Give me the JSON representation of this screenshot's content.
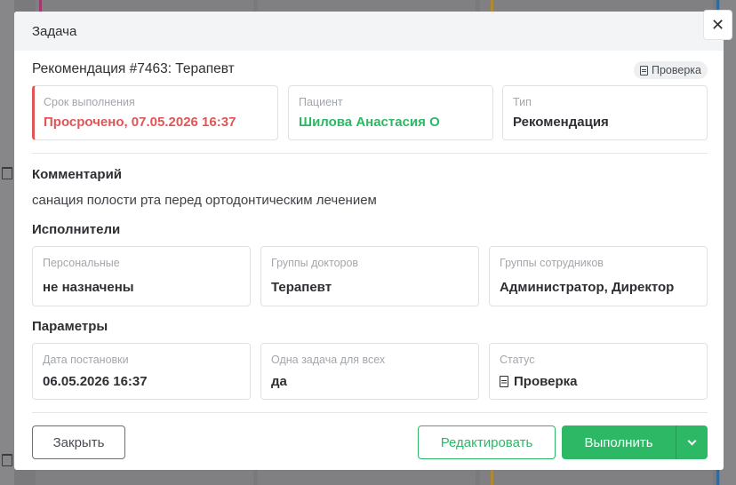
{
  "modal": {
    "title": "Задача",
    "close_glyph": "✕"
  },
  "task": {
    "title": "Рекомендация #7463: Терапевт",
    "status_badge": "Проверка"
  },
  "summary": {
    "deadline": {
      "label": "Срок выполнения",
      "value": "Просрочено, 07.05.2026 16:37"
    },
    "patient": {
      "label": "Пациент",
      "value": "Шилова Анастасия О"
    },
    "type": {
      "label": "Тип",
      "value": "Рекомендация"
    }
  },
  "comment": {
    "title": "Комментарий",
    "text": "санация полости рта перед ортодонтическим лечением"
  },
  "assignees": {
    "title": "Исполнители",
    "personal": {
      "label": "Персональные",
      "value": "не назначены"
    },
    "doctor_groups": {
      "label": "Группы докторов",
      "value": "Терапевт"
    },
    "staff_groups": {
      "label": "Группы сотрудников",
      "value": "Администратор, Директор"
    }
  },
  "params": {
    "title": "Параметры",
    "created": {
      "label": "Дата постановки",
      "value": "06.05.2026 16:37"
    },
    "single_task": {
      "label": "Одна задача для всех",
      "value": "да"
    },
    "status": {
      "label": "Статус",
      "value": "Проверка"
    }
  },
  "footer": {
    "close_label": "Закрыть",
    "edit_label": "Редактировать",
    "done_label": "Выполнить"
  },
  "colors": {
    "accent_green": "#2db866",
    "overdue_red": "#e05555"
  },
  "icons": {
    "status_badge_icon": "document-icon",
    "status_value_icon": "document-icon",
    "split_button_icon": "chevron-down-icon"
  }
}
